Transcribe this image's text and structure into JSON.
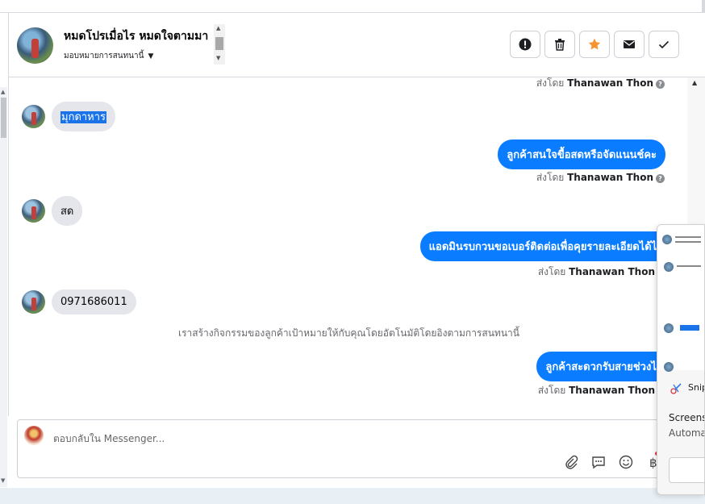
{
  "header": {
    "conversation_name": "หมดโปรเมื่อไร หมดใจตามมา",
    "assign_label": "มอบหมายการสนทนานี้",
    "buttons": {
      "spam": "spam-icon",
      "delete": "trash-icon",
      "star": "star-icon",
      "mail": "mail-icon",
      "done": "check-icon"
    }
  },
  "messages": {
    "sent_by_prefix": "ส่งโดย",
    "agent_name": "Thanawan Thon",
    "m0_selected": "มุกดาหาร",
    "m1": "ลูกค้าสนใจขื้อสดหรือจัดแนนช์คะ",
    "m2": "สด",
    "m3": "แอดมินรบกวนขอเบอร์ติดต่อเพื่อคุยรายละเอียดได้ไหมคะ",
    "m4": "0971686011",
    "system_note": "เราสร้างกิจกรรมของลูกค้าเป้าหมายให้กับคุณโดยอัตโนมัติโดยอิงตามการสนทนานี้",
    "m5": "ลูกค้าสะดวกรับสายช่วงไหนคะ"
  },
  "composer": {
    "placeholder": "ตอบกลับใน Messenger...",
    "icons": [
      "attachment-icon",
      "saved-reply-icon",
      "emoji-icon",
      "baht-icon"
    ]
  },
  "snip_popup": {
    "app_name": "Snip",
    "line1": "Screens",
    "line2": "Automa"
  },
  "colors": {
    "outgoing_bubble": "#0a7cff",
    "incoming_bubble": "#e4e6eb",
    "star": "#f7932c"
  }
}
